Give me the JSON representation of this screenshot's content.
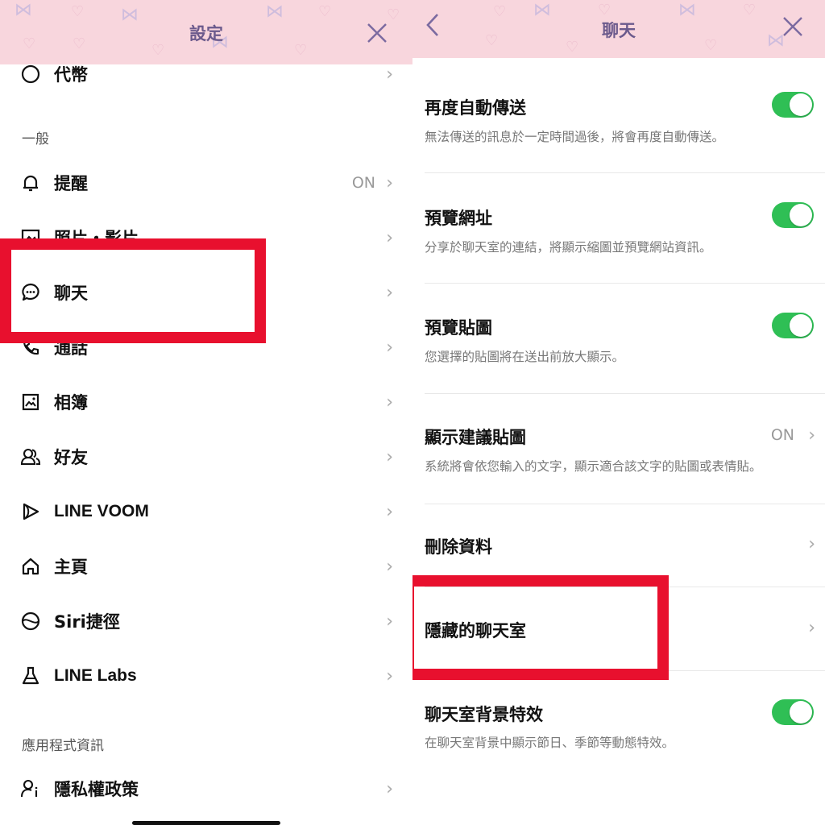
{
  "left": {
    "title": "設定",
    "top_cut_item": "代幣",
    "section_general": "一般",
    "items": [
      {
        "label": "提醒",
        "status": "ON",
        "icon": "bell-icon"
      },
      {
        "label": "照片・影片",
        "icon": "photo-icon"
      },
      {
        "label": "聊天",
        "icon": "chat-icon"
      },
      {
        "label": "通話",
        "icon": "phone-icon"
      },
      {
        "label": "相簿",
        "icon": "album-icon"
      },
      {
        "label": "好友",
        "icon": "friends-icon"
      },
      {
        "label": "LINE VOOM",
        "icon": "voom-icon"
      },
      {
        "label": "主頁",
        "icon": "home-icon"
      },
      {
        "label": "Siri捷徑",
        "icon": "siri-icon"
      },
      {
        "label": "LINE Labs",
        "icon": "flask-icon"
      }
    ],
    "section_app_info": "應用程式資訊",
    "privacy": {
      "label": "隱私權政策",
      "icon": "privacy-icon"
    },
    "chevron": "›"
  },
  "right": {
    "title": "聊天",
    "items": [
      {
        "title": "再度自動傳送",
        "desc": "無法傳送的訊息於一定時間過後，將會再度自動傳送。",
        "toggle": true
      },
      {
        "title": "預覽網址",
        "desc": "分享於聊天室的連結，將顯示縮圖並預覽網站資訊。",
        "toggle": true
      },
      {
        "title": "預覽貼圖",
        "desc": "您選擇的貼圖將在送出前放大顯示。",
        "toggle": true
      },
      {
        "title": "顯示建議貼圖",
        "status": "ON",
        "desc": "系統將會依您輸入的文字，顯示適合該文字的貼圖或表情貼。"
      },
      {
        "title": "刪除資料"
      },
      {
        "title": "隱藏的聊天室"
      },
      {
        "title": "聊天室背景特效",
        "desc": "在聊天室背景中顯示節日、季節等動態特效。",
        "toggle": true
      }
    ]
  },
  "colors": {
    "header_bg": "#f8d6dd",
    "header_title": "#6b5a8c",
    "toggle_on": "#2fbf55",
    "highlight": "#e8102e"
  }
}
